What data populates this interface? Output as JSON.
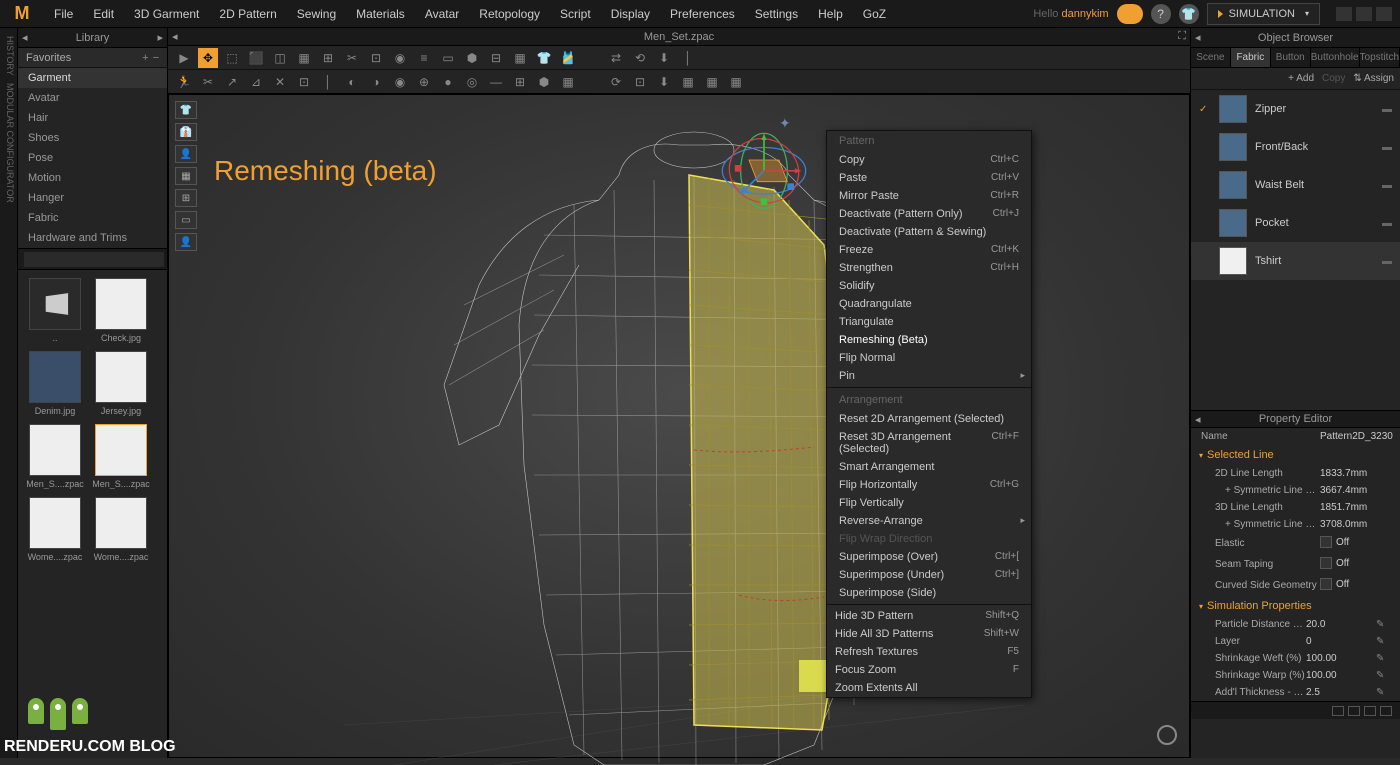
{
  "menubar": [
    "File",
    "Edit",
    "3D Garment",
    "2D Pattern",
    "Sewing",
    "Materials",
    "Avatar",
    "Retopology",
    "Script",
    "Display",
    "Preferences",
    "Settings",
    "Help",
    "GoZ"
  ],
  "hello": "Hello",
  "username": "dannykim",
  "sim_button": "SIMULATION",
  "library": {
    "title": "Library",
    "favorites": "Favorites",
    "cats": [
      "Garment",
      "Avatar",
      "Hair",
      "Shoes",
      "Pose",
      "Motion",
      "Hanger",
      "Fabric",
      "Hardware and Trims"
    ],
    "thumbs": [
      {
        "label": "..",
        "cls": "folder"
      },
      {
        "label": "Check.jpg",
        "cls": ""
      },
      {
        "label": "Denim.jpg",
        "cls": "denim"
      },
      {
        "label": "Jersey.jpg",
        "cls": ""
      },
      {
        "label": "Men_S....zpac",
        "cls": ""
      },
      {
        "label": "Men_S....zpac",
        "cls": "sel"
      },
      {
        "label": "Wome....zpac",
        "cls": ""
      },
      {
        "label": "Wome....zpac",
        "cls": ""
      }
    ]
  },
  "viewport": {
    "title": "Men_Set.zpac",
    "overlay": "Remeshing (beta)"
  },
  "context_menu": {
    "header1": "Pattern",
    "items1": [
      {
        "label": "Copy",
        "sc": "Ctrl+C"
      },
      {
        "label": "Paste",
        "sc": "Ctrl+V"
      },
      {
        "label": "Mirror Paste",
        "sc": "Ctrl+R"
      },
      {
        "label": "Deactivate (Pattern Only)",
        "sc": "Ctrl+J"
      },
      {
        "label": "Deactivate (Pattern & Sewing)",
        "sc": ""
      },
      {
        "label": "Freeze",
        "sc": "Ctrl+K"
      },
      {
        "label": "Strengthen",
        "sc": "Ctrl+H"
      },
      {
        "label": "Solidify",
        "sc": ""
      },
      {
        "label": "Quadrangulate",
        "sc": ""
      },
      {
        "label": "Triangulate",
        "sc": ""
      },
      {
        "label": "Remeshing (Beta)",
        "sc": "",
        "hl": true
      },
      {
        "label": "Flip Normal",
        "sc": ""
      },
      {
        "label": "Pin",
        "sc": "",
        "sub": true
      }
    ],
    "header2": "Arrangement",
    "items2": [
      {
        "label": "Reset 2D Arrangement (Selected)",
        "sc": ""
      },
      {
        "label": "Reset 3D Arrangement (Selected)",
        "sc": "Ctrl+F"
      },
      {
        "label": "Smart Arrangement",
        "sc": ""
      },
      {
        "label": "Flip Horizontally",
        "sc": "Ctrl+G"
      },
      {
        "label": "Flip Vertically",
        "sc": ""
      },
      {
        "label": "Reverse-Arrange",
        "sc": "",
        "sub": true
      },
      {
        "label": "Flip Wrap Direction",
        "sc": "",
        "disabled": true
      },
      {
        "label": "Superimpose (Over)",
        "sc": "Ctrl+["
      },
      {
        "label": "Superimpose (Under)",
        "sc": "Ctrl+]"
      },
      {
        "label": "Superimpose (Side)",
        "sc": ""
      }
    ],
    "items3": [
      {
        "label": "Hide 3D Pattern",
        "sc": "Shift+Q",
        "indent": true
      },
      {
        "label": "Hide All 3D Patterns",
        "sc": "Shift+W",
        "indent": true
      },
      {
        "label": "Refresh Textures",
        "sc": "F5",
        "indent": true
      },
      {
        "label": "Focus Zoom",
        "sc": "F",
        "indent": true
      },
      {
        "label": "Zoom Extents All",
        "sc": "",
        "indent": true
      }
    ]
  },
  "object_browser": {
    "title": "Object Browser",
    "tabs": [
      "Scene",
      "Fabric",
      "Button",
      "Buttonhole",
      "Topstitch"
    ],
    "active_tab": 1,
    "toolbar": {
      "add": "+ Add",
      "copy": "Copy",
      "assign": "⇅  Assign"
    },
    "items": [
      {
        "name": "Zipper",
        "white": false,
        "check": true
      },
      {
        "name": "Front/Back",
        "white": false,
        "check": false
      },
      {
        "name": "Waist Belt",
        "white": false,
        "check": false
      },
      {
        "name": "Pocket",
        "white": false,
        "check": false
      },
      {
        "name": "Tshirt",
        "white": true,
        "check": false,
        "sel": true
      }
    ]
  },
  "property_editor": {
    "title": "Property Editor",
    "name_label": "Name",
    "name_value": "Pattern2D_3230",
    "section1": "Selected Line",
    "rows1": [
      {
        "label": "2D Line Length",
        "val": "1833.7mm"
      },
      {
        "label": "+ Symmetric Line Length",
        "val": "3667.4mm",
        "indent": true
      },
      {
        "label": "3D Line Length",
        "val": "1851.7mm"
      },
      {
        "label": "+ Symmetric Line Length",
        "val": "3708.0mm",
        "indent": true
      },
      {
        "label": "Elastic",
        "val": "Off",
        "toggle": true
      },
      {
        "label": "Seam Taping",
        "val": "Off",
        "toggle": true
      },
      {
        "label": "Curved Side Geometry",
        "val": "Off",
        "toggle": true
      }
    ],
    "section2": "Simulation Properties",
    "rows2": [
      {
        "label": "Particle Distance (mm)",
        "val": "20.0",
        "icon": true
      },
      {
        "label": "Layer",
        "val": "0",
        "icon": true
      },
      {
        "label": "Shrinkage Weft (%)",
        "val": "100.00",
        "icon": true
      },
      {
        "label": "Shrinkage Warp (%)",
        "val": "100.00",
        "icon": true
      },
      {
        "label": "Add'l Thickness - Collision",
        "val": "2.5",
        "icon": true
      }
    ]
  },
  "watermark": "RENDERU.COM BLOG"
}
